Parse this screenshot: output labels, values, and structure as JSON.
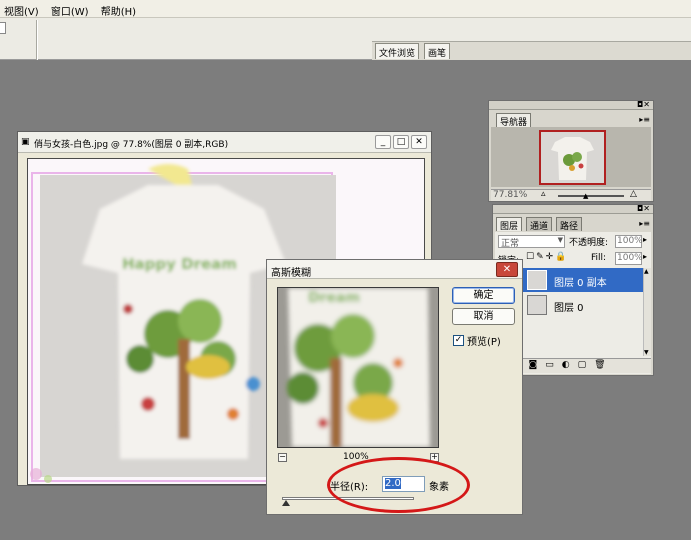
{
  "menubar": {
    "items": [
      "视图(V)",
      "窗口(W)",
      "帮助(H)"
    ]
  },
  "panel_well": {
    "tabs": [
      "文件浏览",
      "画笔"
    ]
  },
  "navigator": {
    "tab": "导航器",
    "zoom": "77.81%"
  },
  "layers_panel": {
    "tabs": [
      "图层",
      "通道",
      "路径"
    ],
    "blend_mode": "正常",
    "opacity_label": "不透明度:",
    "opacity_value": "100%",
    "lock_label": "锁定:",
    "fill_label": "Fill:",
    "fill_value": "100%",
    "layers": [
      {
        "name": "图层 0 副本",
        "selected": true
      },
      {
        "name": "图层 0",
        "selected": false
      }
    ]
  },
  "document": {
    "title": "俏与女孩-白色.jpg @ 77.8%(图层 0 副本,RGB)",
    "shirt_text": "Happy Dream"
  },
  "dialog": {
    "title": "高斯模糊",
    "ok_label": "确定",
    "cancel_label": "取消",
    "preview_label": "预览(P)",
    "preview_checked": true,
    "zoom": "100%",
    "radius_label": "半径(R):",
    "radius_value": "2.0",
    "radius_unit": "象素",
    "radius_slider_fraction": 0.03
  },
  "colors": {
    "annotation": "#d41818",
    "selection": "#316ac5",
    "workspace": "#7d7d7d"
  }
}
